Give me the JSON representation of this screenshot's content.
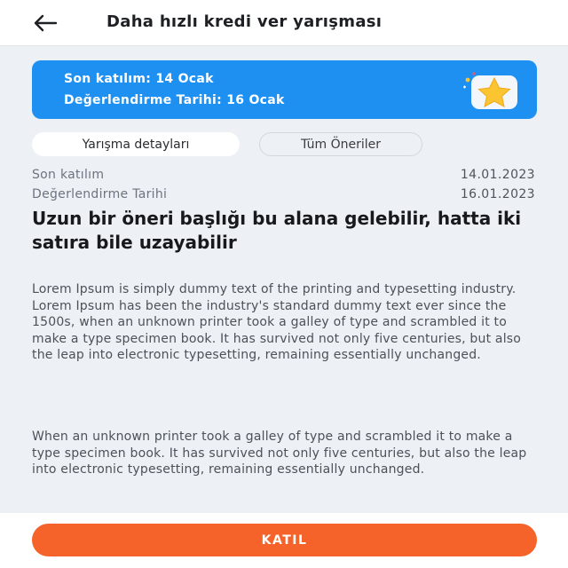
{
  "header": {
    "title": "Daha hızlı kredi ver yarışması",
    "back_icon": "arrow-left-icon"
  },
  "banner": {
    "line1": "Son katılım: 14 Ocak",
    "line2": "Değerlendirme Tarihi: 16 Ocak",
    "icon": "star-icon",
    "color": "#1e90f2"
  },
  "tabs": [
    {
      "label": "Yarışma detayları",
      "active": true
    },
    {
      "label": "Tüm Öneriler",
      "active": false
    }
  ],
  "meta": [
    {
      "label": "Son katılım",
      "value": "14.01.2023"
    },
    {
      "label": "Değerlendirme Tarihi",
      "value": "16.01.2023"
    }
  ],
  "article": {
    "title": "Uzun bir öneri başlığı bu alana gelebilir, hatta iki satıra bile uzayabilir",
    "paragraphs": [
      "Lorem Ipsum is simply dummy text of the printing and typesetting industry. Lorem Ipsum has been the industry's standard dummy text ever since the 1500s, when an unknown printer took a galley of type and scrambled it to make a type specimen book. It has survived not only five centuries, but also the leap into electronic typesetting, remaining essentially unchanged.",
      "When an unknown printer took a galley of type and scrambled it to make a type specimen book. It has survived not only five centuries, but also the leap into electronic typesetting, remaining essentially unchanged."
    ]
  },
  "footer": {
    "join_label": "KATIL",
    "accent": "#f5622a"
  }
}
